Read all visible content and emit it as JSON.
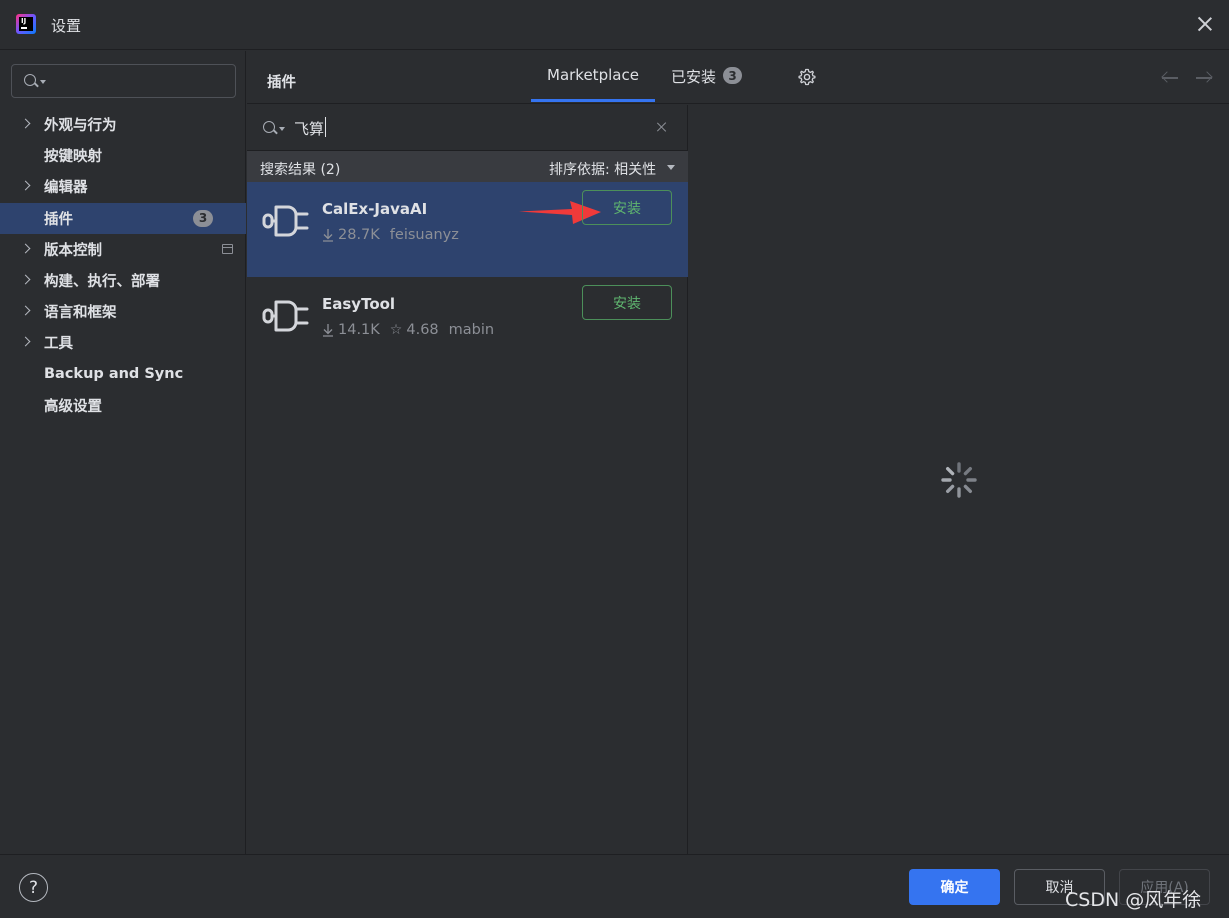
{
  "window": {
    "title": "设置",
    "close_icon": "close-icon"
  },
  "sidebar": {
    "search_placeholder": "",
    "items": [
      {
        "label": "外观与行为",
        "expandable": true
      },
      {
        "label": "按键映射",
        "expandable": false
      },
      {
        "label": "编辑器",
        "expandable": true
      },
      {
        "label": "插件",
        "expandable": false,
        "selected": true,
        "badge": "3"
      },
      {
        "label": "版本控制",
        "expandable": true,
        "icon": "project-scope-icon"
      },
      {
        "label": "构建、执行、部署",
        "expandable": true
      },
      {
        "label": "语言和框架",
        "expandable": true
      },
      {
        "label": "工具",
        "expandable": true
      },
      {
        "label": "Backup and Sync",
        "expandable": false
      },
      {
        "label": "高级设置",
        "expandable": false
      }
    ]
  },
  "header": {
    "section_title": "插件",
    "tabs": [
      {
        "label": "Marketplace",
        "active": true
      },
      {
        "label": "已安装",
        "badge": "3"
      }
    ],
    "settings_icon": "gear-icon"
  },
  "plugins": {
    "search_query": "飞算",
    "results_label": "搜索结果 (2)",
    "sort_label": "排序依据: 相关性",
    "items": [
      {
        "name": "CalEx-JavaAI",
        "downloads": "28.7K",
        "rating": "",
        "vendor": "feisuanyz",
        "install_label": "安装",
        "selected": true
      },
      {
        "name": "EasyTool",
        "downloads": "14.1K",
        "rating": "4.68",
        "vendor": "mabin",
        "install_label": "安装",
        "selected": false
      }
    ]
  },
  "footer": {
    "help_label": "?",
    "ok_label": "确定",
    "cancel_label": "取消",
    "apply_label": "应用(A)",
    "watermark": "CSDN @风年徐"
  },
  "colors": {
    "background": "#2b2d30",
    "selection": "#2e436e",
    "accent": "#3574f0",
    "install_green": "#5fb56f",
    "annotation_red": "#f03a3a"
  }
}
